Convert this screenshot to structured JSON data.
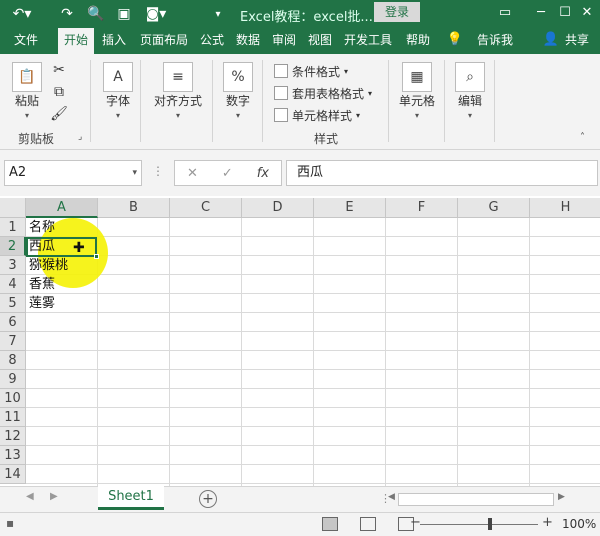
{
  "titlebar": {
    "title": "Excel教程：excel批...",
    "login": "登录",
    "icons": [
      "undo-icon",
      "redo-icon",
      "print-preview-icon",
      "save-icon",
      "camera-icon",
      "customize-qat-icon"
    ],
    "window_buttons": [
      "ribbon-display-icon",
      "minimize-icon",
      "maximize-icon",
      "close-icon"
    ]
  },
  "tabs": [
    "文件",
    "开始",
    "插入",
    "页面布局",
    "公式",
    "数据",
    "审阅",
    "视图",
    "开发工具",
    "帮助"
  ],
  "tell_me": "告诉我",
  "share": "共享",
  "ribbon": {
    "paste": "粘贴",
    "clipboard_group": "剪贴板",
    "font": "字体",
    "alignment": "对齐方式",
    "number": "数字",
    "number_symbol": "%",
    "conditional_format": "条件格式",
    "table_format": "套用表格格式",
    "cell_style": "单元格样式",
    "styles_group": "样式",
    "cells": "单元格",
    "editing": "编辑"
  },
  "formula_bar": {
    "name_box": "A2",
    "fx": "fx",
    "value": "西瓜"
  },
  "grid": {
    "columns": [
      "A",
      "B",
      "C",
      "D",
      "E",
      "F",
      "G",
      "H"
    ],
    "rows": [
      "1",
      "2",
      "3",
      "4",
      "5",
      "6",
      "7",
      "8",
      "9",
      "10",
      "11",
      "12",
      "13",
      "14"
    ],
    "cells": [
      "名称",
      "西瓜",
      "猕猴桃",
      "香蕉",
      "莲雾"
    ],
    "selected_cell": "A2"
  },
  "sheets": {
    "active": "Sheet1"
  },
  "status": {
    "zoom": "100%"
  }
}
